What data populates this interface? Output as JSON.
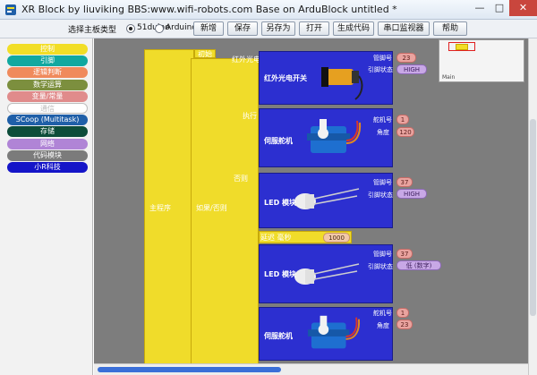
{
  "window": {
    "title": "XR Block by liuviking BBS:www.wifi-robots.com  Base on ArduBlock untitled *",
    "minimize": "—",
    "maximize": "□",
    "close": "✕"
  },
  "toolbar": {
    "board_label": "选择主板类型",
    "board_options": [
      {
        "label": "51duino",
        "selected": true
      },
      {
        "label": "Arduino",
        "selected": false
      }
    ],
    "buttons": [
      "新增",
      "保存",
      "另存为",
      "打开",
      "生成代码",
      "串口监视器",
      "帮助"
    ]
  },
  "sidebar": {
    "categories": [
      {
        "label": "控制",
        "color": "#f2de26",
        "text_color": "#ffffff"
      },
      {
        "label": "引脚",
        "color": "#11a8a0",
        "text_color": "#ffffff"
      },
      {
        "label": "逻辑判断",
        "color": "#f08a5c",
        "text_color": "#ffffff"
      },
      {
        "label": "数学运算",
        "color": "#7c8f3e",
        "text_color": "#ffffff"
      },
      {
        "label": "变量/常量",
        "color": "#e08b8b",
        "text_color": "#ffffff"
      },
      {
        "label": "通信",
        "color": "#ffffff",
        "text_color": "#ffffff"
      },
      {
        "label": "SCoop (Multitask)",
        "color": "#1f5fa8",
        "text_color": "#ffffff"
      },
      {
        "label": "存储",
        "color": "#0d4d3a",
        "text_color": "#ffffff"
      },
      {
        "label": "网络",
        "color": "#b084d6",
        "text_color": "#ffffff"
      },
      {
        "label": "代码模块",
        "color": "#7b7b7b",
        "text_color": "#ffffff"
      },
      {
        "label": "小R科技",
        "color": "#1515c8",
        "text_color": "#ffffff"
      }
    ]
  },
  "workspace": {
    "main_block_label": "主程序",
    "loop_block_label": "如果/否则",
    "setup_label": "初始",
    "do_label": "执行",
    "else_label": "否则",
    "delay": {
      "label": "延迟 毫秒",
      "unit": "毫秒",
      "value": "1000"
    },
    "blocks": [
      {
        "kind": "ir_sensor",
        "header": "红外光电开关",
        "title": "红外光电开关",
        "params": [
          {
            "label": "管脚号",
            "value": "23",
            "pill": "red"
          },
          {
            "label": "引脚状态",
            "value": "HIGH",
            "pill": "purple"
          }
        ]
      },
      {
        "kind": "servo",
        "header": "执行",
        "title": "伺服舵机",
        "params": [
          {
            "label": "舵机号",
            "value": "1",
            "pill": "red"
          },
          {
            "label": "角度",
            "value": "120",
            "pill": "red"
          }
        ]
      },
      {
        "kind": "led",
        "header": "否则执行",
        "title": "LED 模块",
        "params": [
          {
            "label": "管脚号",
            "value": "37",
            "pill": "red"
          },
          {
            "label": "引脚状态",
            "value": "HIGH",
            "pill": "purple"
          }
        ]
      },
      {
        "kind": "led",
        "header": "",
        "title": "LED 模块",
        "params": [
          {
            "label": "管脚号",
            "value": "37",
            "pill": "red"
          },
          {
            "label": "引脚状态",
            "value": "低 (数字)",
            "pill": "purple"
          }
        ]
      },
      {
        "kind": "servo",
        "header": "",
        "title": "伺服舵机",
        "params": [
          {
            "label": "舵机号",
            "value": "1",
            "pill": "red"
          },
          {
            "label": "角度",
            "value": "23",
            "pill": "red"
          }
        ]
      }
    ]
  },
  "minimap": {
    "label": "Main"
  },
  "colors": {
    "control": "#f0dc2a",
    "component": "#2c2fd0",
    "workspace": "#7d7d7d",
    "scroll_thumb": "#3a6fd8"
  }
}
